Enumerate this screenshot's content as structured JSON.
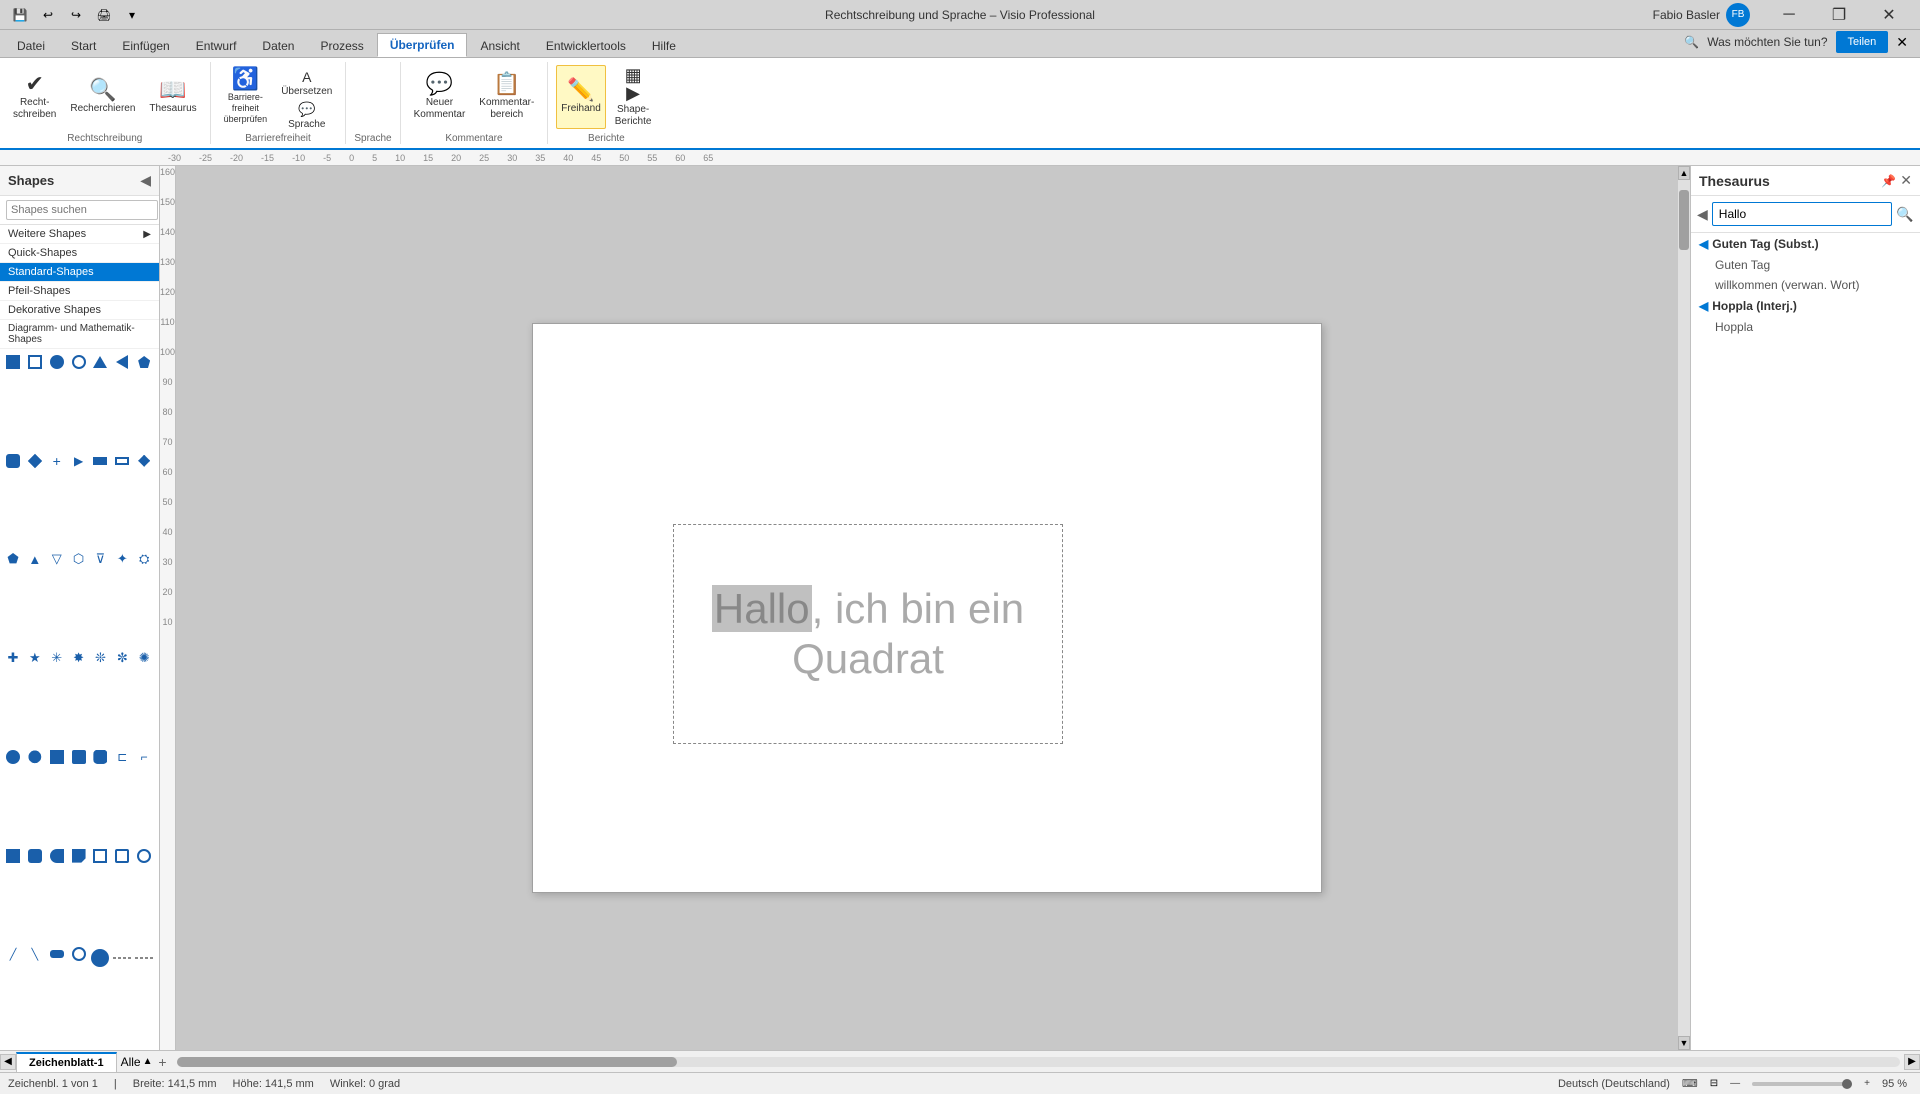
{
  "titlebar": {
    "title": "Rechtschreibung und Sprache – Visio Professional",
    "user": "Fabio Basler",
    "qat_buttons": [
      "save",
      "undo",
      "redo",
      "print",
      "dropdown"
    ],
    "win_buttons": [
      "minimize",
      "restore",
      "close"
    ]
  },
  "ribbon_tabs": {
    "tabs": [
      "Datei",
      "Start",
      "Einfügen",
      "Entwurf",
      "Daten",
      "Prozess",
      "Überprüfen",
      "Ansicht",
      "Entwicklertools",
      "Hilfe"
    ],
    "active": "Überprüfen",
    "search_placeholder": "Was möchten Sie tun?"
  },
  "ribbon": {
    "groups": [
      {
        "label": "Rechtschreibung",
        "items": [
          {
            "id": "rechtschreibung",
            "icon": "✔",
            "label": "Recht-\nschreiben"
          },
          {
            "id": "recherchieren",
            "icon": "🔍",
            "label": "Recherchieren"
          },
          {
            "id": "thesaurus",
            "icon": "📖",
            "label": "Thesaurus"
          }
        ]
      },
      {
        "label": "Barrierefreiheit",
        "items": [
          {
            "id": "barrierefreiheit",
            "icon": "♿",
            "label": "Barriere-\nfreiheit\nüberprüfen"
          },
          {
            "id": "uebersetzen",
            "icon": "A",
            "label": "Übersetzen"
          },
          {
            "id": "sprache",
            "icon": "💬",
            "label": "Sprache"
          }
        ]
      },
      {
        "label": "Kommentare",
        "items": [
          {
            "id": "neuer-kommentar",
            "icon": "💬",
            "label": "Neuer\nKommentar"
          },
          {
            "id": "kommentarbereich",
            "icon": "📋",
            "label": "Kommentar-\nbereich"
          }
        ]
      },
      {
        "label": "Berichte",
        "items": [
          {
            "id": "freihand",
            "icon": "✏",
            "label": "Freihand",
            "active": true
          },
          {
            "id": "shape-berichte",
            "icon": "📊",
            "label": "Shape-\nBerichte"
          }
        ]
      }
    ]
  },
  "shapes_panel": {
    "title": "Shapes",
    "search_placeholder": "Shapes suchen",
    "categories": [
      {
        "label": "Weitere Shapes",
        "arrow": "▶",
        "selected": false
      },
      {
        "label": "Quick-Shapes",
        "selected": false
      },
      {
        "label": "Standard-Shapes",
        "selected": true
      },
      {
        "label": "Pfeil-Shapes",
        "selected": false
      },
      {
        "label": "Dekorative Shapes",
        "selected": false
      },
      {
        "label": "Diagramm- und Mathematik-Shapes",
        "selected": false
      }
    ]
  },
  "canvas": {
    "text_line1": "Hallo, ich bin ein",
    "text_line2": "Quadrat",
    "highlighted_word": "Hallo"
  },
  "thesaurus_panel": {
    "title": "Thesaurus",
    "search_value": "Hallo",
    "results": [
      {
        "section": "Guten Tag (Subst.)",
        "expanded": true,
        "entries": [
          "Guten Tag",
          "willkommen (verwan. Wort)"
        ]
      },
      {
        "section": "Hoppla (Interj.)",
        "expanded": true,
        "entries": [
          "Hoppla"
        ]
      }
    ]
  },
  "sheet_tabs": {
    "tabs": [
      "Zeichenblatt-1"
    ],
    "active": "Zeichenblatt-1",
    "page_indicator": "Alle"
  },
  "status_bar": {
    "drawing": "Zeichenbl. 1 von 1",
    "width": "Breite: 141,5 mm",
    "height": "Höhe: 141,5 mm",
    "angle": "Winkel: 0 grad",
    "language": "Deutsch (Deutschland)",
    "zoom": "95 %"
  }
}
